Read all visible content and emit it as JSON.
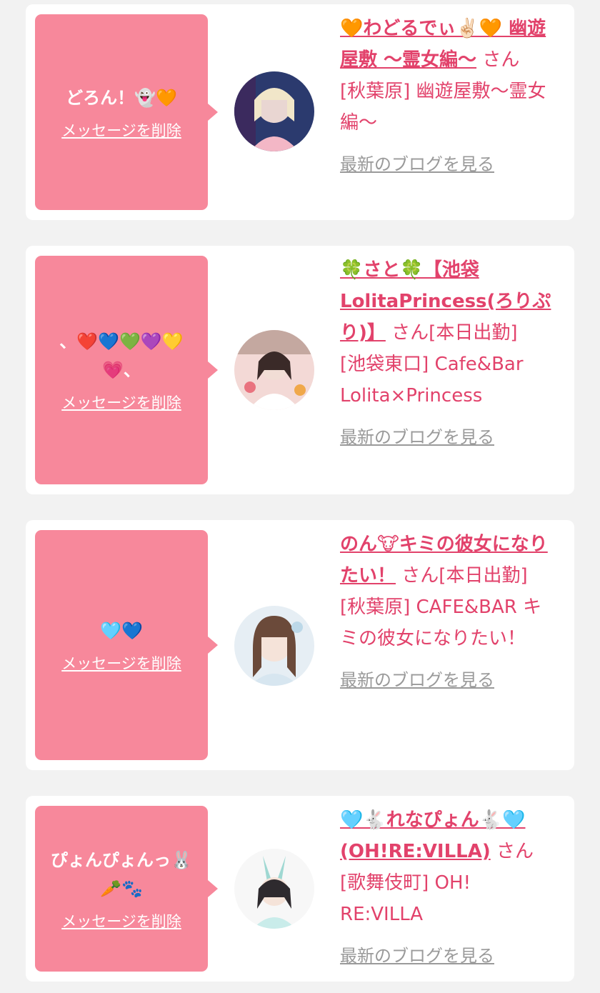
{
  "items": [
    {
      "message": "どろん！👻🧡",
      "delete_label": "メッセージを削除",
      "name": "🧡わどるでぃ✌🏻🧡 幽遊屋敷 〜霊女編〜",
      "honorific": "さん",
      "status": "",
      "location": "[秋葉原] 幽遊屋敷〜霊女編〜",
      "blog_label": "最新のブログを見る",
      "avatar_icon": "girl-photo-avatar-icon"
    },
    {
      "message": "、❤️💙💚💜💛\n💗、",
      "delete_label": "メッセージを削除",
      "name": "🍀さと🍀【池袋LolitaPrincess(ろりぷり)】",
      "honorific": "さん",
      "status": "[本日出勤]",
      "location": "[池袋東口] Cafe&Bar Lolita×Princess",
      "blog_label": "最新のブログを見る",
      "avatar_icon": "girl-photo-avatar-icon"
    },
    {
      "message": "🩵💙",
      "delete_label": "メッセージを削除",
      "name": "のん🐮キミの彼女になりたい！",
      "honorific": "さん",
      "status": "[本日出勤]",
      "location": "[秋葉原] CAFE&BAR キミの彼女になりたい！",
      "blog_label": "最新のブログを見る",
      "avatar_icon": "girl-photo-avatar-icon"
    },
    {
      "message": "ぴょんぴょんっ🐰\n🥕🐾",
      "delete_label": "メッセージを削除",
      "name": "🩵🐇れなぴょん🐇🩵(OH!RE:VILLA)",
      "honorific": "さん",
      "status": "",
      "location": "[歌舞伎町] OH! RE:VILLA",
      "blog_label": "最新のブログを見る",
      "avatar_icon": "girl-photo-avatar-icon"
    }
  ]
}
